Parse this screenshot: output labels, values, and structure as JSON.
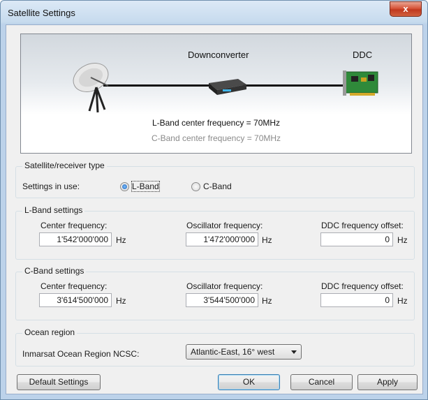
{
  "window": {
    "title": "Satellite Settings",
    "close_glyph": "x"
  },
  "banner": {
    "downconverter_label": "Downconverter",
    "ddc_label": "DDC",
    "lband_freq_text": "L-Band center frequency = 70MHz",
    "cband_freq_text": "C-Band center frequency = 70MHz",
    "icons": [
      "satellite-dish-icon",
      "downconverter-device-icon",
      "ddc-card-icon"
    ]
  },
  "receiver_type": {
    "title": "Satellite/receiver type",
    "settings_label": "Settings in use:",
    "options": [
      {
        "label": "L-Band",
        "selected": true
      },
      {
        "label": "C-Band",
        "selected": false
      }
    ]
  },
  "lband": {
    "title": "L-Band settings",
    "center_label": "Center frequency:",
    "center_value": "1'542'000'000",
    "osc_label": "Oscillator frequency:",
    "osc_value": "1'472'000'000",
    "ddc_label": "DDC frequency offset:",
    "ddc_value": "0",
    "unit": "Hz"
  },
  "cband": {
    "title": "C-Band settings",
    "center_label": "Center frequency:",
    "center_value": "3'614'500'000",
    "osc_label": "Oscillator frequency:",
    "osc_value": "3'544'500'000",
    "ddc_label": "DDC frequency offset:",
    "ddc_value": "0",
    "unit": "Hz"
  },
  "ocean": {
    "title": "Ocean region",
    "label": "Inmarsat Ocean Region NCSC:",
    "selected": "Atlantic-East, 16° west"
  },
  "buttons": {
    "default_settings": "Default Settings",
    "ok": "OK",
    "cancel": "Cancel",
    "apply": "Apply"
  },
  "colors": {
    "accent": "#3c7fb1",
    "close": "#c0391f",
    "muted_text": "#8a8a8a"
  }
}
